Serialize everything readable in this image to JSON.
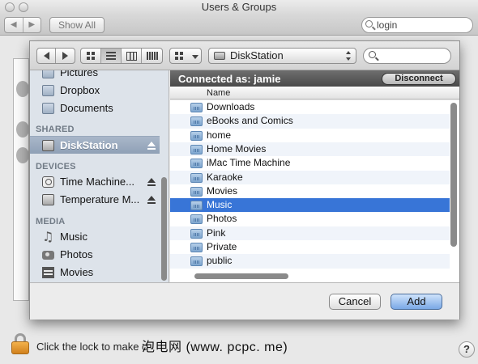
{
  "window": {
    "title": "Users & Groups",
    "show_all_label": "Show All",
    "search_value": "login",
    "lock_text": "Click the lock to make c",
    "help_label": "?",
    "watermark": "泡电网 (www. pcpc. me)"
  },
  "toolbar": {
    "location_label": "DiskStation"
  },
  "sidebar": {
    "items": [
      {
        "label": "Pictures",
        "icon": "folder-icon"
      },
      {
        "label": "Dropbox",
        "icon": "folder-icon"
      },
      {
        "label": "Documents",
        "icon": "folder-icon"
      }
    ],
    "shared_header": "SHARED",
    "shared_items": [
      {
        "label": "DiskStation",
        "selected": true
      }
    ],
    "devices_header": "DEVICES",
    "devices": [
      {
        "label": "Time Machine..."
      },
      {
        "label": "Temperature M..."
      }
    ],
    "media_header": "MEDIA",
    "media": [
      {
        "label": "Music"
      },
      {
        "label": "Photos"
      },
      {
        "label": "Movies"
      }
    ]
  },
  "connection": {
    "label": "Connected as: jamie",
    "disconnect_label": "Disconnect"
  },
  "file_list": {
    "column_name": "Name",
    "rows": [
      "Downloads",
      "eBooks and Comics",
      "home",
      "Home Movies",
      "iMac Time Machine",
      "Karaoke",
      "Movies",
      "Music",
      "Photos",
      "Pink",
      "Private",
      "public"
    ],
    "selected": "Music"
  },
  "footer": {
    "cancel_label": "Cancel",
    "add_label": "Add"
  },
  "colors": {
    "selection": "#3875d7",
    "sidebar_bg": "#dde3ea",
    "lock_orange": "#e79a34"
  }
}
